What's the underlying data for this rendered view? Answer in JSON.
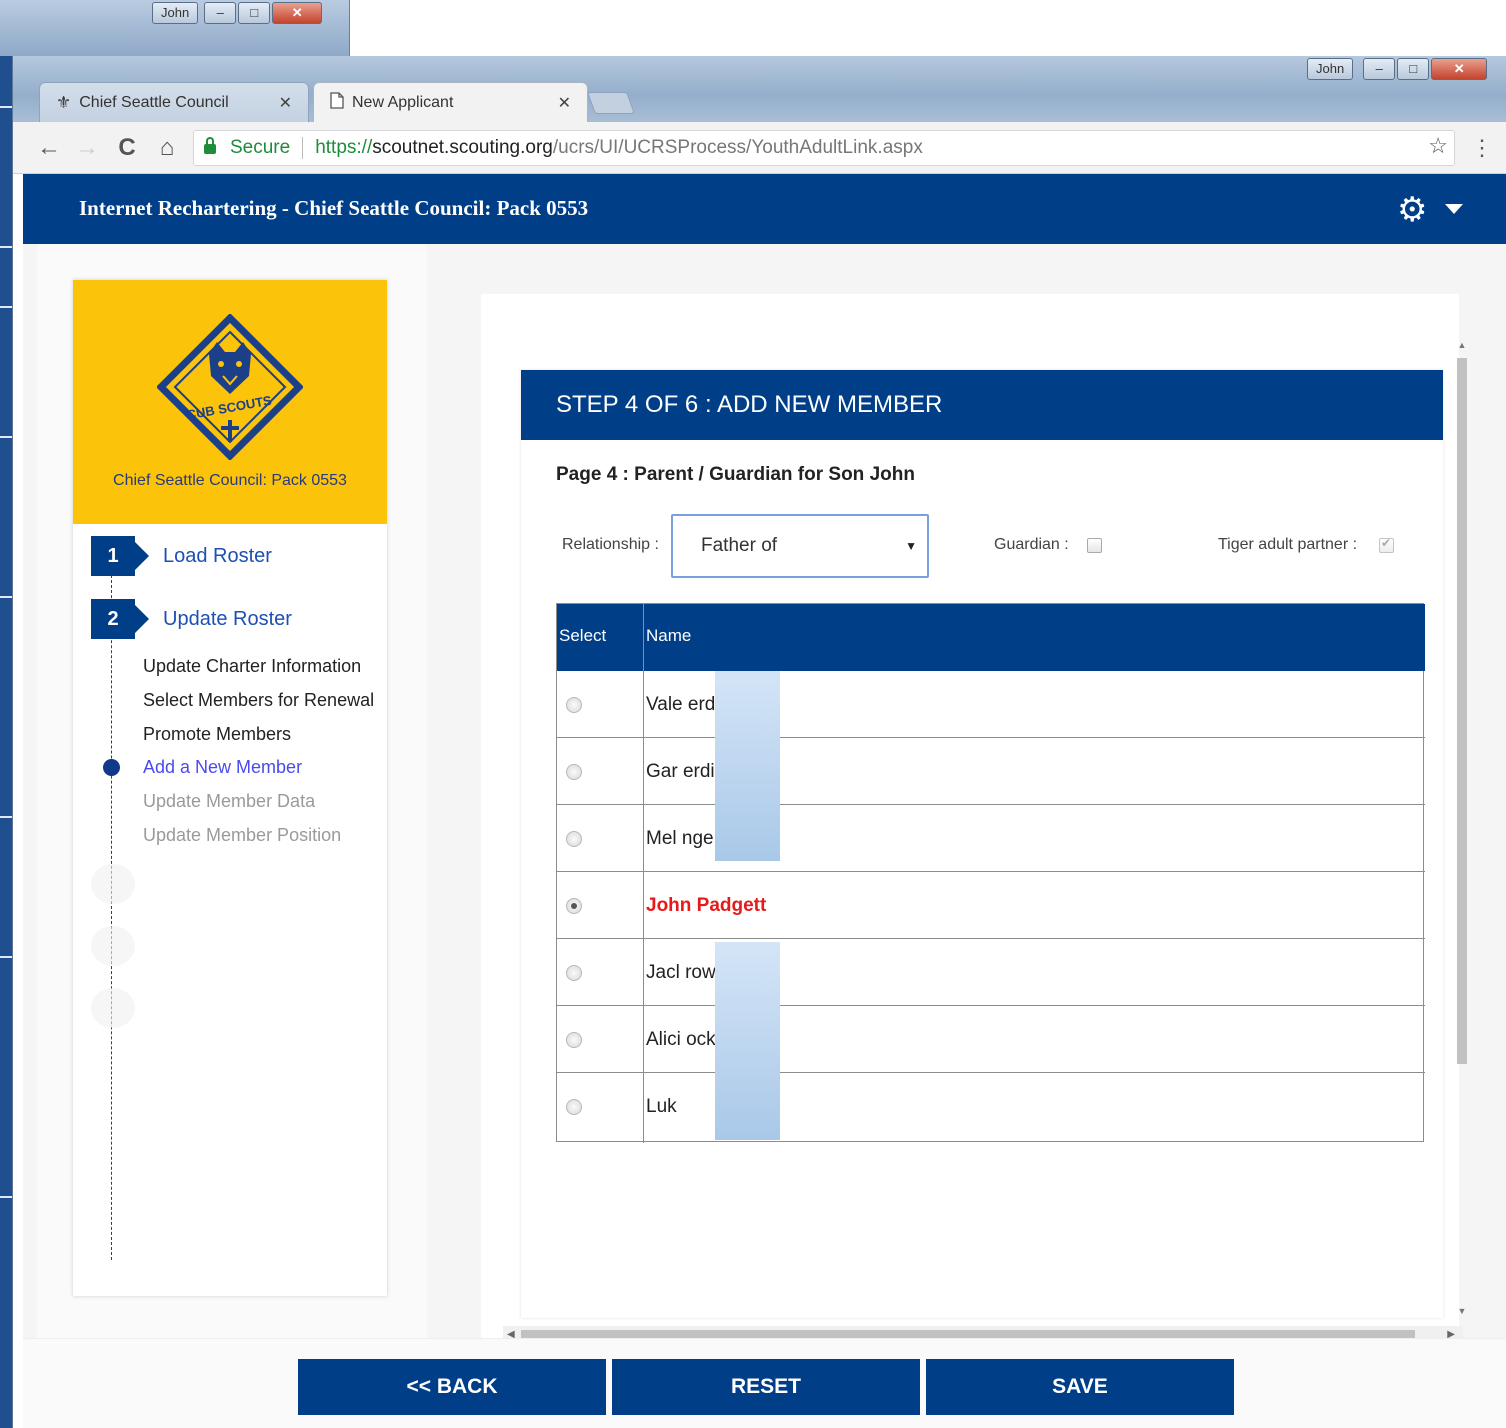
{
  "background_window": {
    "user_label": "John",
    "controls": [
      "–",
      "□",
      "✕"
    ]
  },
  "window": {
    "user_label": "John",
    "controls": [
      "–",
      "□",
      "✕"
    ]
  },
  "browser": {
    "tabs": [
      {
        "label": "Chief Seattle Council",
        "icon": "fleur-de-lis-icon",
        "active": false
      },
      {
        "label": "New Applicant",
        "icon": "page-icon",
        "active": true
      }
    ],
    "tab_close": "✕",
    "nav": {
      "back": "←",
      "forward": "→",
      "reload": "C",
      "home": "⌂"
    },
    "secure_label": "Secure",
    "url": {
      "protocol": "https://",
      "host": "scoutnet.scouting.org",
      "path": "/ucrs/UI/UCRSProcess/YouthAdultLink.aspx"
    },
    "star": "☆",
    "menu": "⋮"
  },
  "header": {
    "title": "Internet Rechartering - Chief Seattle Council: Pack 0553",
    "settings_icon": "⚙"
  },
  "sidebar": {
    "logo_caption": "Chief Seattle Council: Pack 0553",
    "logo_text": "CUB SCOUTS",
    "steps": [
      {
        "number": "1",
        "label": "Load Roster"
      },
      {
        "number": "2",
        "label": "Update Roster"
      }
    ],
    "substeps": [
      {
        "label": "Update Charter Information",
        "state": "done"
      },
      {
        "label": "Select Members for Renewal",
        "state": "done"
      },
      {
        "label": "Promote Members",
        "state": "done"
      },
      {
        "label": "Add a New Member",
        "state": "current"
      },
      {
        "label": "Update Member Data",
        "state": "pending"
      },
      {
        "label": "Update Member Position",
        "state": "pending"
      }
    ]
  },
  "panel": {
    "heading": "STEP 4 OF 6 : ADD NEW MEMBER",
    "page_title": "Page 4 : Parent / Guardian for Son John",
    "relationship_label": "Relationship :",
    "relationship_value": "Father of",
    "guardian_label": "Guardian :",
    "guardian_checked": false,
    "tiger_label": "Tiger adult partner :",
    "tiger_checked": true,
    "table": {
      "headers": [
        "Select",
        "Name"
      ],
      "rows": [
        {
          "name": "Vale        erdike",
          "selected": false
        },
        {
          "name": "Gar          erdike",
          "selected": false
        },
        {
          "name": "Mel          nge",
          "selected": false
        },
        {
          "name": "John Padgett",
          "selected": true
        },
        {
          "name": "Jacl          row",
          "selected": false
        },
        {
          "name": "Alici          ock",
          "selected": false
        },
        {
          "name": "Luk",
          "selected": false
        }
      ]
    }
  },
  "footer": {
    "back_label": "<< BACK",
    "reset_label": "RESET",
    "save_label": "SAVE"
  },
  "colors": {
    "brand_blue": "#003f87",
    "cub_yellow": "#fcc30b",
    "selected_name": "#e51b1b",
    "secure_green": "#1e8c3a"
  }
}
